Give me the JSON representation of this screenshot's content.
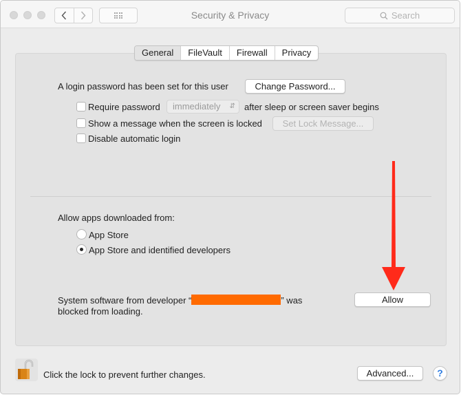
{
  "window": {
    "title": "Security & Privacy",
    "search_placeholder": "Search"
  },
  "tabs": [
    {
      "label": "General",
      "active": true
    },
    {
      "label": "FileVault",
      "active": false
    },
    {
      "label": "Firewall",
      "active": false
    },
    {
      "label": "Privacy",
      "active": false
    }
  ],
  "general": {
    "login_password_text": "A login password has been set for this user",
    "change_password_label": "Change Password...",
    "require_password": {
      "label": "Require password",
      "checked": false
    },
    "require_password_select": "immediately",
    "require_password_suffix": "after sleep or screen saver begins",
    "show_message": {
      "label": "Show a message when the screen is locked",
      "checked": false
    },
    "set_lock_message_label": "Set Lock Message...",
    "disable_auto_login": {
      "label": "Disable automatic login",
      "checked": false
    }
  },
  "gatekeeper": {
    "heading": "Allow apps downloaded from:",
    "options": [
      {
        "label": "App Store",
        "selected": false
      },
      {
        "label": "App Store and identified developers",
        "selected": true
      }
    ]
  },
  "blocked": {
    "line1_prefix": "System software from developer “",
    "line1_suffix": "” was",
    "line2": "blocked from loading.",
    "redaction_color": "#ff6a00",
    "allow_label": "Allow"
  },
  "annotation": {
    "arrow_color": "#ff2a1a"
  },
  "footer": {
    "lock_text": "Click the lock to prevent further changes.",
    "advanced_label": "Advanced...",
    "help_label": "?"
  }
}
